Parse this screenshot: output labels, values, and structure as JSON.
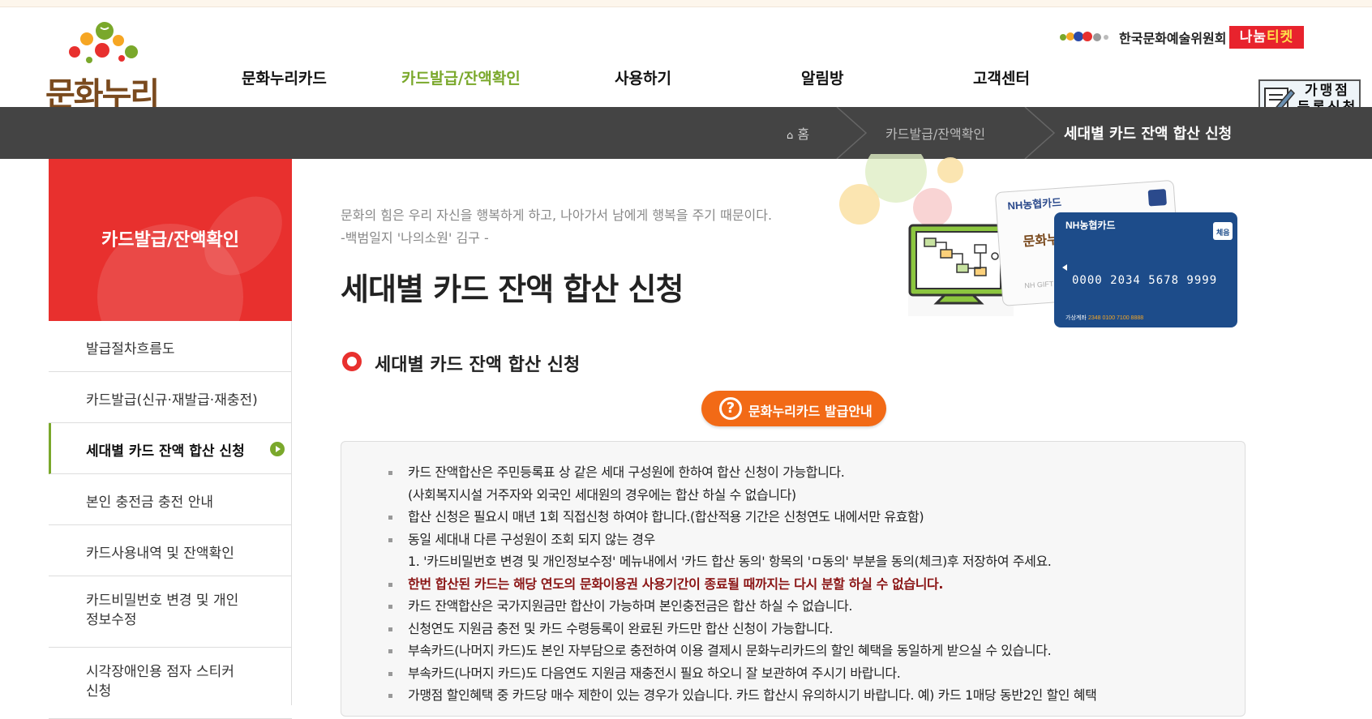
{
  "header": {
    "logo_text": "문화누리",
    "nav": [
      {
        "label": "문화누리카드",
        "active": false
      },
      {
        "label": "카드발급/잔액확인",
        "active": true
      },
      {
        "label": "사용하기",
        "active": false
      },
      {
        "label": "알림방",
        "active": false
      },
      {
        "label": "고객센터",
        "active": false
      }
    ],
    "partner_text": "한국문화예술위원회",
    "ticket_part1": "나눔",
    "ticket_part2": "티켓",
    "merchant_line1": "가맹점",
    "merchant_line2": "등록신청"
  },
  "breadcrumb": {
    "home": "홈",
    "level1": "카드발급/잔액확인",
    "current": "세대별 카드 잔액 합산 신청"
  },
  "sidebar": {
    "title": "카드발급/잔액확인",
    "items": [
      {
        "label": "발급절차흐름도"
      },
      {
        "label": "카드발급(신규·재발급·재충전)"
      },
      {
        "label": "세대별 카드 잔액 합산 신청"
      },
      {
        "label": "본인 충전금 충전 안내"
      },
      {
        "label": "카드사용내역 및 잔액확인"
      },
      {
        "label_line1": "카드비밀번호 변경 및 개인",
        "label_line2": "정보수정"
      },
      {
        "label_line1": "시각장애인용 점자 스티커",
        "label_line2": "신청"
      }
    ]
  },
  "main": {
    "quote_line1": "문화의 힘은 우리 자신을 행복하게 하고, 나아가서 남에게 행복을 주기 때문이다.",
    "quote_line2": "-백범일지 '나의소원' 김구 -",
    "title": "세대별 카드 잔액 합산 신청",
    "section_title": "세대별 카드 잔액 합산 신청",
    "issue_button": "문화누리카드 발급안내",
    "hero": {
      "card_brand": "NH농협카드",
      "card_number": "0000 2034 5678 9999",
      "card_badge": "체음",
      "card_small": "가상계좌",
      "card_account": "2348 0100 7100 8888",
      "front_name": "문화누리",
      "front_gift": "NH GIFT CA"
    },
    "notes": [
      {
        "text": "카드 잔액합산은 주민등록표 상 같은 세대 구성원에 한하여 합산 신청이 가능합니다.",
        "bullet": true,
        "red": false
      },
      {
        "text": "(사회복지시설 거주자와 외국인 세대원의 경우에는 합산 하실 수 없습니다)",
        "bullet": false,
        "red": false
      },
      {
        "text": "합산 신청은 필요시 매년 1회 직접신청 하여야 합니다.(합산적용 기간은 신청연도 내에서만 유효함)",
        "bullet": true,
        "red": false
      },
      {
        "text": "동일 세대내 다른 구성원이 조회 되지 않는 경우",
        "bullet": true,
        "red": false
      },
      {
        "text": "1. '카드비밀번호 변경 및 개인정보수정' 메뉴내에서 '카드 합산 동의' 항목의 'ㅁ동의' 부분을 동의(체크)후 저장하여 주세요.",
        "bullet": false,
        "red": false
      },
      {
        "text": "한번 합산된 카드는 해당 연도의 문화이용권 사용기간이 종료될 때까지는 다시 분할 하실 수 없습니다.",
        "bullet": true,
        "red": true
      },
      {
        "text": "카드 잔액합산은 국가지원금만 합산이 가능하며 본인충전금은 합산 하실 수 없습니다.",
        "bullet": true,
        "red": false
      },
      {
        "text": "신청연도 지원금 충전 및 카드 수령등록이 완료된 카드만 합산 신청이 가능합니다.",
        "bullet": true,
        "red": false
      },
      {
        "text": "부속카드(나머지 카드)도 본인 자부담으로 충전하여 이용 결제시 문화누리카드의 할인 혜택을 동일하게 받으실 수 있습니다.",
        "bullet": true,
        "red": false
      },
      {
        "text": "부속카드(나머지 카드)도 다음연도 지원금 재충전시 필요 하오니 잘 보관하여 주시기 바랍니다.",
        "bullet": true,
        "red": false
      },
      {
        "text": "가맹점 할인혜택 중 카드당 매수 제한이 있는 경우가 있습니다. 카드 합산시 유의하시기 바랍니다. 예) 카드 1매당 동반2인 할인 혜택",
        "bullet": true,
        "red": false
      }
    ]
  },
  "colors": {
    "accent_green": "#7aa82b",
    "accent_red": "#e8302e",
    "button_orange": "#f26a16",
    "crumb_bg": "#444444"
  }
}
